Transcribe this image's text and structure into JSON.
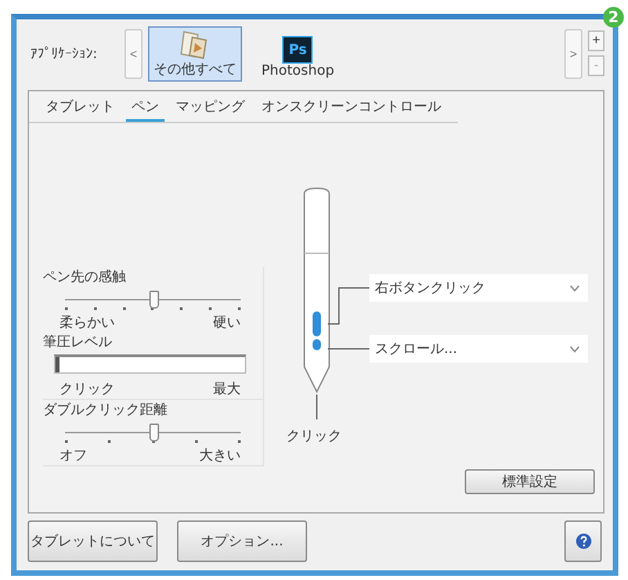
{
  "application_bar": {
    "label": "ｱﾌﾟﾘｹｰｼｮﾝ:",
    "prev": "<",
    "next": ">",
    "add": "+",
    "remove": "-",
    "apps": [
      {
        "name": "その他すべて",
        "selected": true,
        "kind": "all"
      },
      {
        "name": "Photoshop",
        "selected": false,
        "kind": "ps",
        "icon_text": "Ps"
      }
    ]
  },
  "badge": "2",
  "tabs": [
    {
      "label": "タブレット",
      "selected": false
    },
    {
      "label": "ペン",
      "selected": true
    },
    {
      "label": "マッピング",
      "selected": false
    },
    {
      "label": "オンスクリーンコントロール",
      "selected": false
    }
  ],
  "tip_feel": {
    "title": "ペン先の感触",
    "level": 0.5,
    "min_label": "柔らかい",
    "max_label": "硬い"
  },
  "pressure": {
    "title": "筆圧レベル",
    "level": 0.02,
    "min_label": "クリック",
    "max_label": "最大"
  },
  "double_click": {
    "title": "ダブルクリック距離",
    "level": 0.5,
    "min_label": "オフ",
    "max_label": "大きい"
  },
  "pen": {
    "upper_button": "右ボタンクリック",
    "lower_button": "スクロール...",
    "tip": "クリック"
  },
  "default_button": "標準設定",
  "footer": {
    "about": "タブレットについて",
    "options": "オプション..."
  }
}
